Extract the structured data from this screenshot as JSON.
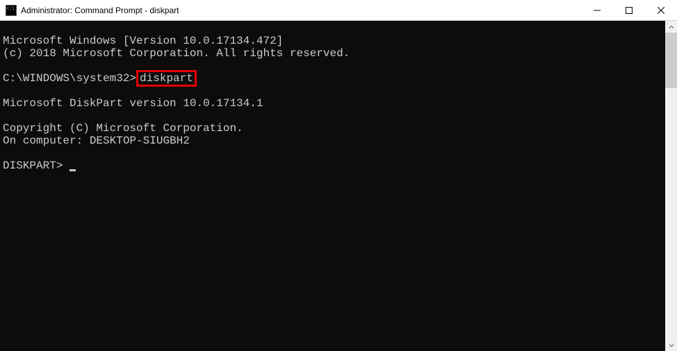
{
  "titlebar": {
    "title": "Administrator: Command Prompt - diskpart"
  },
  "terminal": {
    "line1": "Microsoft Windows [Version 10.0.17134.472]",
    "line2": "(c) 2018 Microsoft Corporation. All rights reserved.",
    "prompt1_path": "C:\\WINDOWS\\system32>",
    "prompt1_command": "diskpart",
    "line3": "Microsoft DiskPart version 10.0.17134.1",
    "line4": "Copyright (C) Microsoft Corporation.",
    "line5": "On computer: DESKTOP-SIUGBH2",
    "prompt2": "DISKPART> "
  }
}
